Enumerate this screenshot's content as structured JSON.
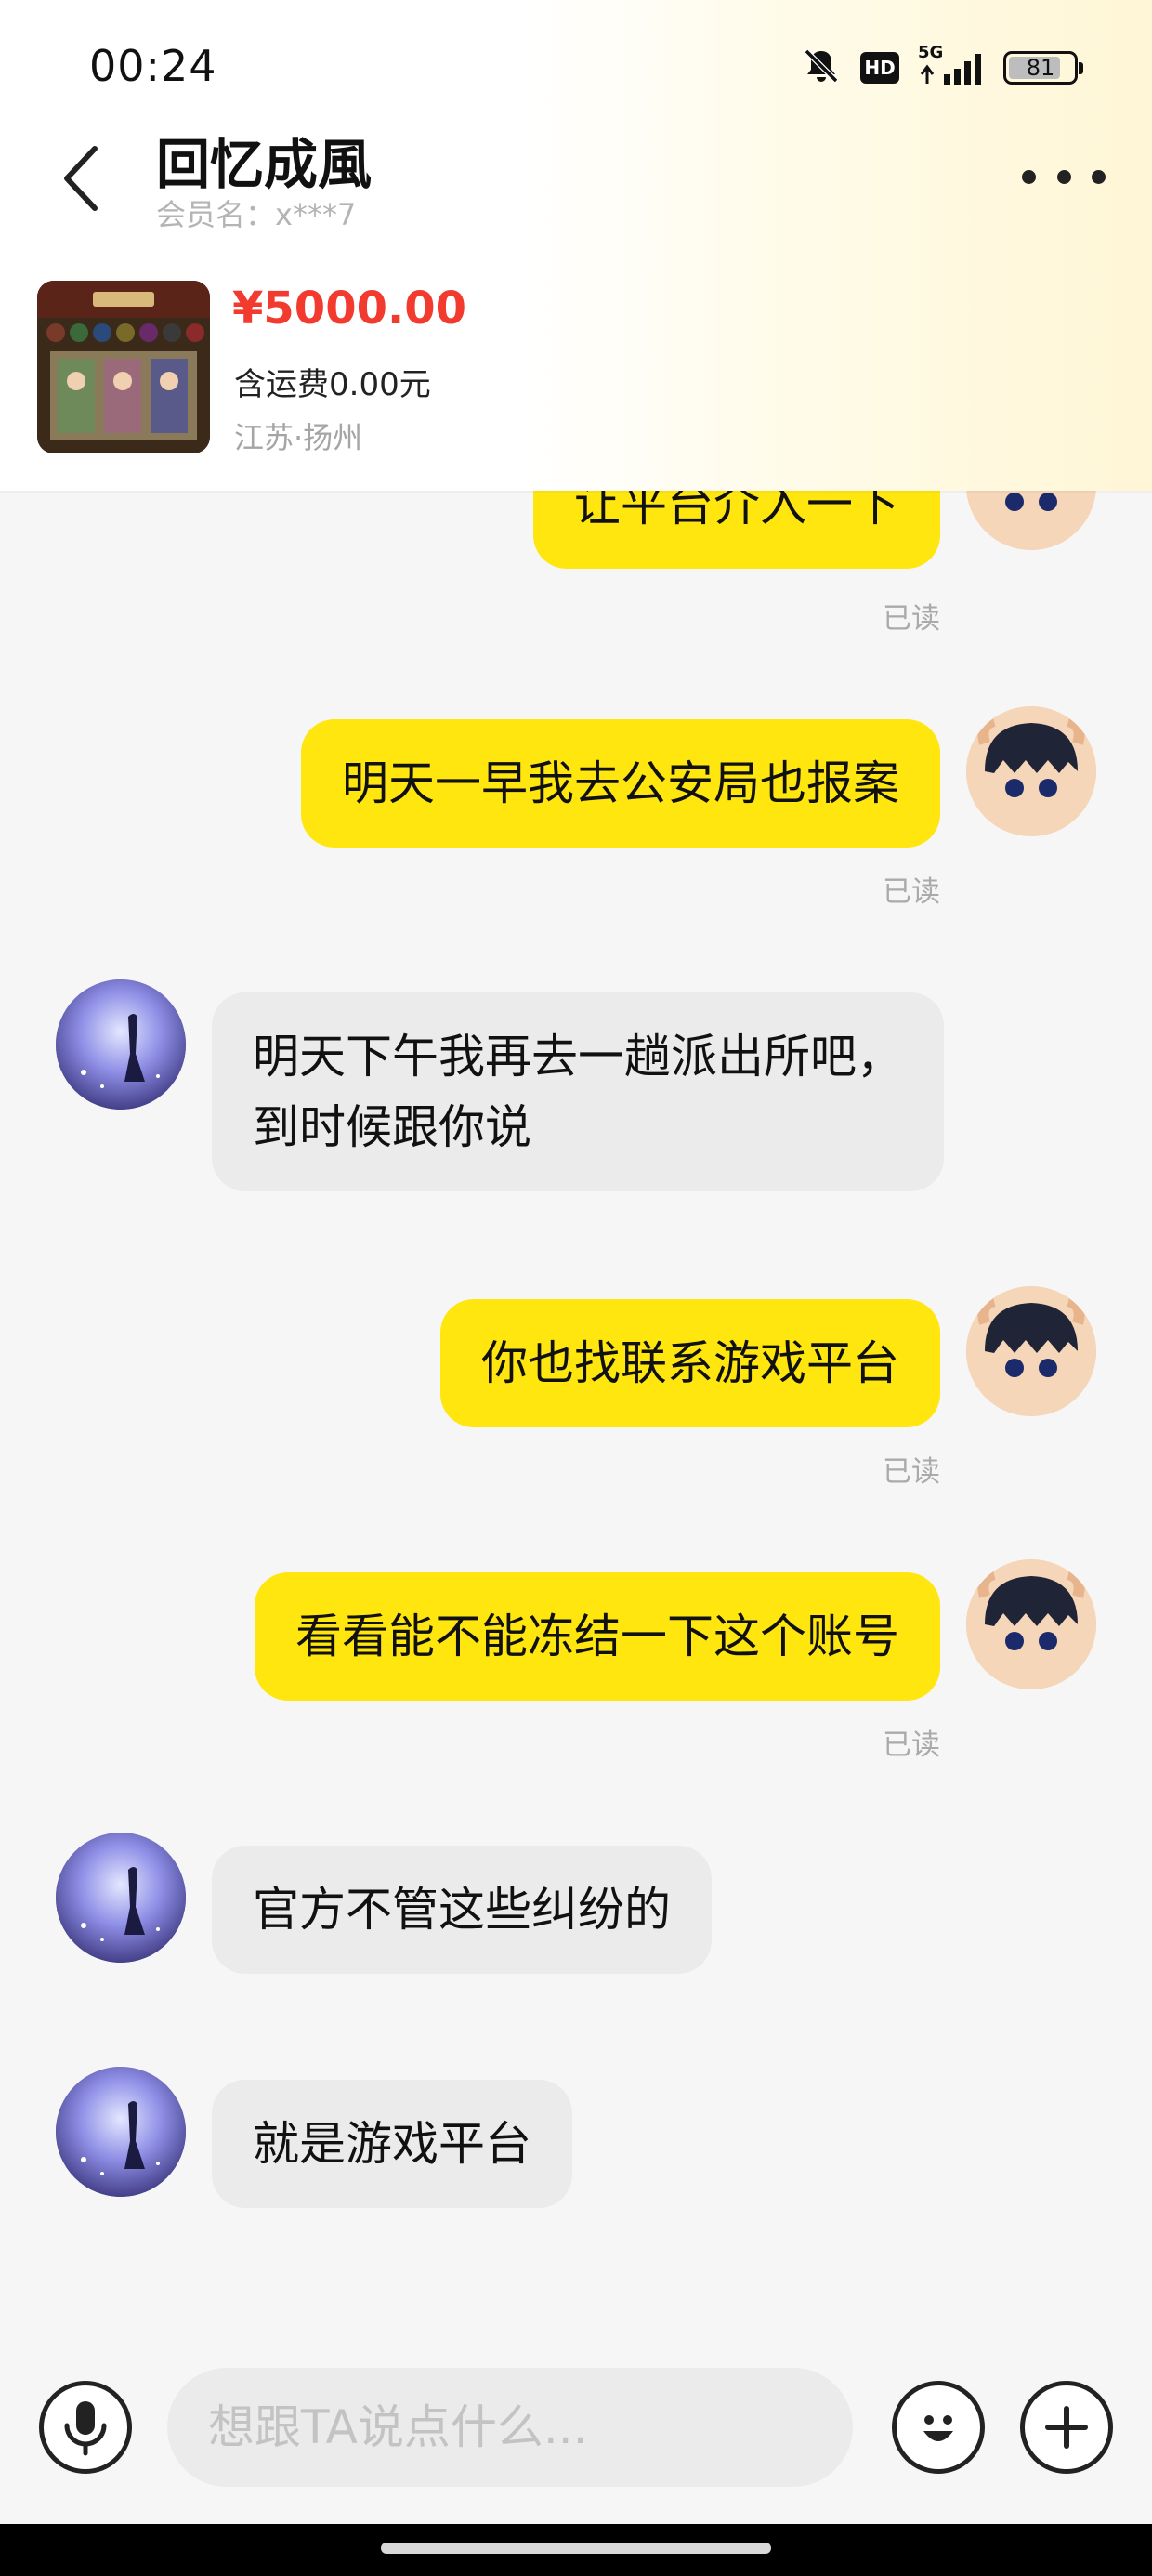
{
  "status_bar": {
    "time": "00:24",
    "hd_label": "HD",
    "network_label": "5G",
    "battery": "81",
    "battery_level": 0.81
  },
  "header": {
    "contact_name": "回忆成風",
    "member_label": "会员名：x***7"
  },
  "product": {
    "price": "¥5000.00",
    "shipping": "含运费0.00元",
    "location": "江苏·扬州"
  },
  "messages": [
    {
      "from": "me",
      "text": "让平台介入一下",
      "read": "已读"
    },
    {
      "from": "me",
      "text": "明天一早我去公安局也报案",
      "read": "已读"
    },
    {
      "from": "them",
      "lines": [
        "明天下午我再去一趟派出所吧，",
        "到时候跟你说"
      ]
    },
    {
      "from": "me",
      "text": "你也找联系游戏平台",
      "read": "已读"
    },
    {
      "from": "me",
      "text": "看看能不能冻结一下这个账号",
      "read": "已读"
    },
    {
      "from": "them",
      "text": "官方不管这些纠纷的"
    },
    {
      "from": "them",
      "text": "就是游戏平台"
    }
  ],
  "input": {
    "placeholder": "想跟TA说点什么..."
  },
  "icons": {
    "back": "chevron-left-icon",
    "more": "more-dots-icon",
    "mute": "bell-off-icon",
    "signal": "signal-icon",
    "voice": "microphone-icon",
    "emoji": "smiley-icon",
    "add": "plus-icon"
  },
  "colors": {
    "accent_yellow": "#ffe60f",
    "price_red": "#f33a2e",
    "incoming_bubble": "#ebebeb"
  }
}
